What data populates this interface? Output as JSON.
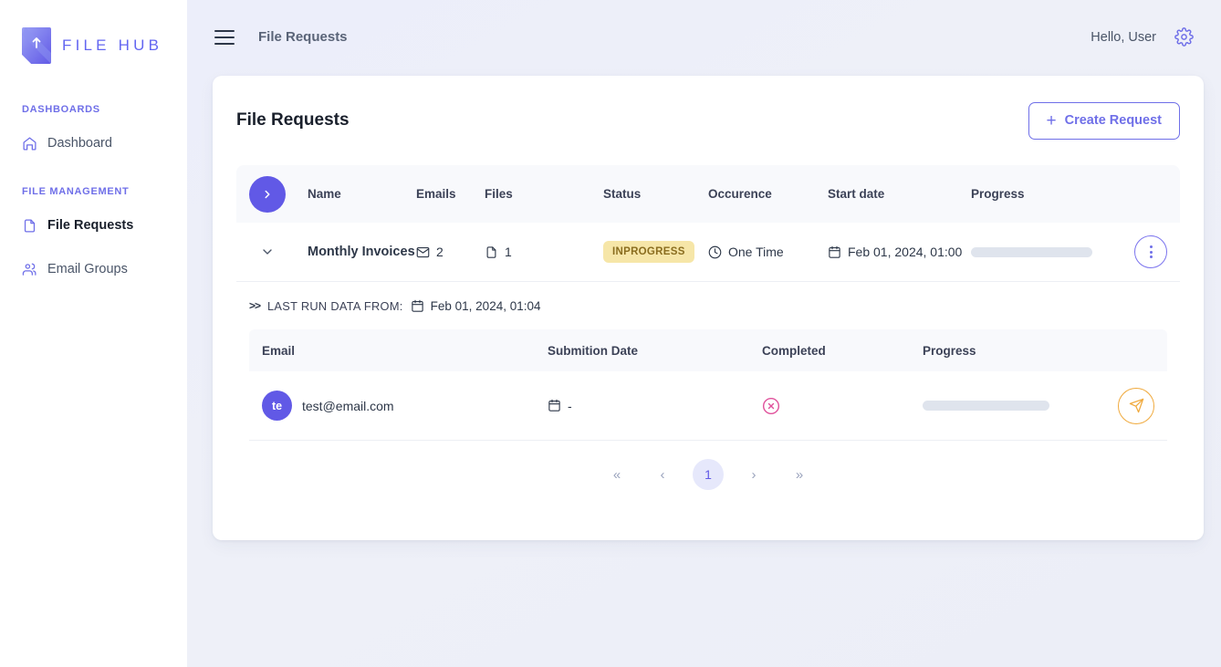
{
  "brand": {
    "name": "FILE HUB",
    "logo_icon": "file-upload-logo-icon",
    "accent": "#6366f1"
  },
  "sidebar": {
    "sections": [
      {
        "title": "DASHBOARDS",
        "items": [
          {
            "label": "Dashboard",
            "icon": "home-icon",
            "active": false
          }
        ]
      },
      {
        "title": "FILE MANAGEMENT",
        "items": [
          {
            "label": "File Requests",
            "icon": "file-icon",
            "active": true
          },
          {
            "label": "Email Groups",
            "icon": "users-icon",
            "active": false
          }
        ]
      }
    ]
  },
  "topbar": {
    "menu_icon": "hamburger-icon",
    "title": "File Requests",
    "greeting": "Hello, User",
    "settings_icon": "gear-icon"
  },
  "card": {
    "title": "File Requests",
    "create_button": {
      "label": "Create Request",
      "icon": "plus-icon"
    }
  },
  "requests_table": {
    "expand_all_icon": "chevron-right-icon",
    "columns": [
      "Name",
      "Emails",
      "Files",
      "Status",
      "Occurence",
      "Start date",
      "Progress"
    ],
    "rows": [
      {
        "expand_icon": "chevron-down-icon",
        "name": "Monthly Invoices",
        "emails": "2",
        "emails_icon": "envelope-icon",
        "files": "1",
        "files_icon": "file-icon",
        "status": "INPROGRESS",
        "status_bg": "#f6e6a8",
        "status_color": "#8a6d1f",
        "occurence": "One Time",
        "occurence_icon": "clock-icon",
        "start_date": "Feb 01, 2024, 01:00",
        "start_date_icon": "calendar-icon",
        "progress": 0,
        "menu_icon": "three-dots-icon"
      }
    ]
  },
  "last_run": {
    "prefix": ">>",
    "label": "LAST RUN DATA FROM:",
    "date": "Feb 01, 2024, 01:04",
    "date_icon": "calendar-icon"
  },
  "submissions_table": {
    "columns": [
      "Email",
      "Submition Date",
      "Completed",
      "Progress"
    ],
    "rows": [
      {
        "avatar_initials": "te",
        "email": "test@email.com",
        "submition_date": "-",
        "submition_date_icon": "calendar-icon",
        "completed_icon": "x-circle-icon",
        "completed_color": "#e0529c",
        "progress": 0,
        "action_icon": "send-icon",
        "action_color": "#f0a93c"
      }
    ]
  },
  "pagination": {
    "first": "«",
    "prev": "‹",
    "current": "1",
    "next": "›",
    "last": "»"
  }
}
